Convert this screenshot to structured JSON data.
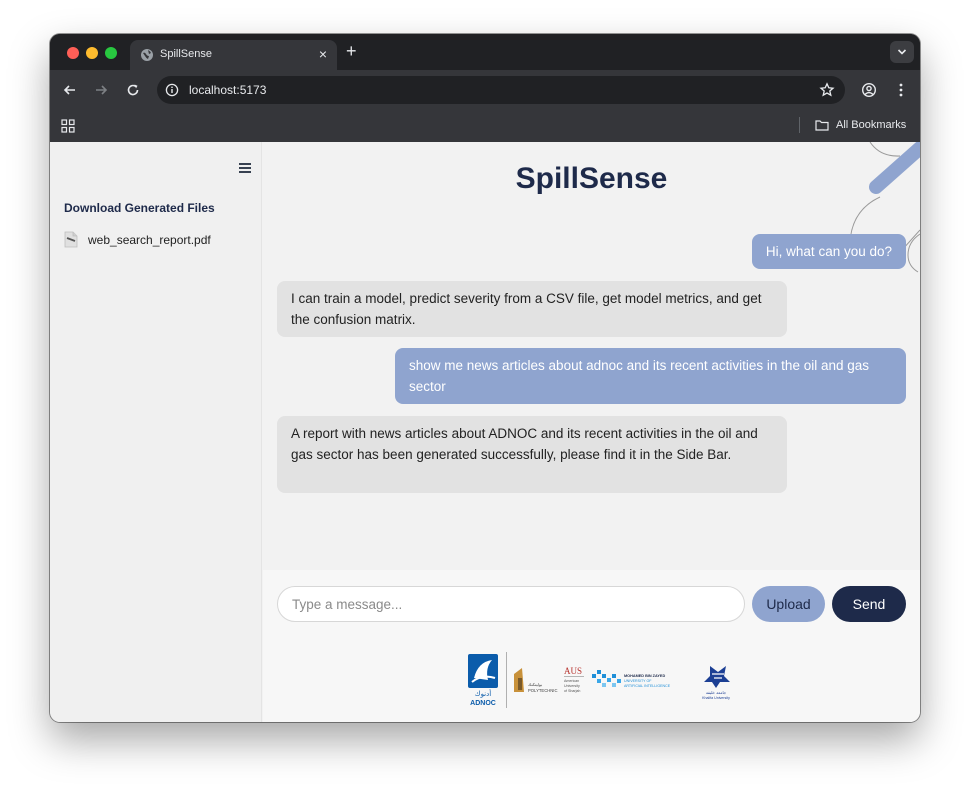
{
  "browser": {
    "tab_title": "SpillSense",
    "url": "localhost:5173",
    "bookmarks_label": "All Bookmarks"
  },
  "sidebar": {
    "heading": "Download Generated Files",
    "files": [
      "web_search_report.pdf"
    ]
  },
  "main": {
    "title": "SpillSense",
    "messages": [
      {
        "role": "user",
        "text": "Hi, what can you do?"
      },
      {
        "role": "assistant",
        "text": "I can train a model, predict severity from a CSV file, get model metrics, and get the confusion matrix."
      },
      {
        "role": "user",
        "text": "show me news articles about adnoc and its recent activities in the oil and gas sector"
      },
      {
        "role": "assistant",
        "text": "A report with news articles about ADNOC and its recent activities in the oil and gas sector has been generated successfully, please find it in the Side Bar."
      }
    ]
  },
  "composer": {
    "placeholder": "Type a message...",
    "upload_label": "Upload",
    "send_label": "Send"
  },
  "footer_logos": {
    "adnoc": "ADNOC",
    "polytechnic": "POLYTECHNIC",
    "aus": "AUS",
    "aus_sub": "American University of Sharjah",
    "mbzuai_line1": "MOHAMED BIN ZAYED",
    "mbzuai_line2": "UNIVERSITY OF",
    "mbzuai_line3": "ARTIFICIAL INTELLIGENCE",
    "khalifa": "Khalifa University"
  },
  "colors": {
    "brand_navy": "#1e2a4a",
    "user_bubble": "#8fa4cf",
    "bot_bubble": "#e2e2e2"
  }
}
